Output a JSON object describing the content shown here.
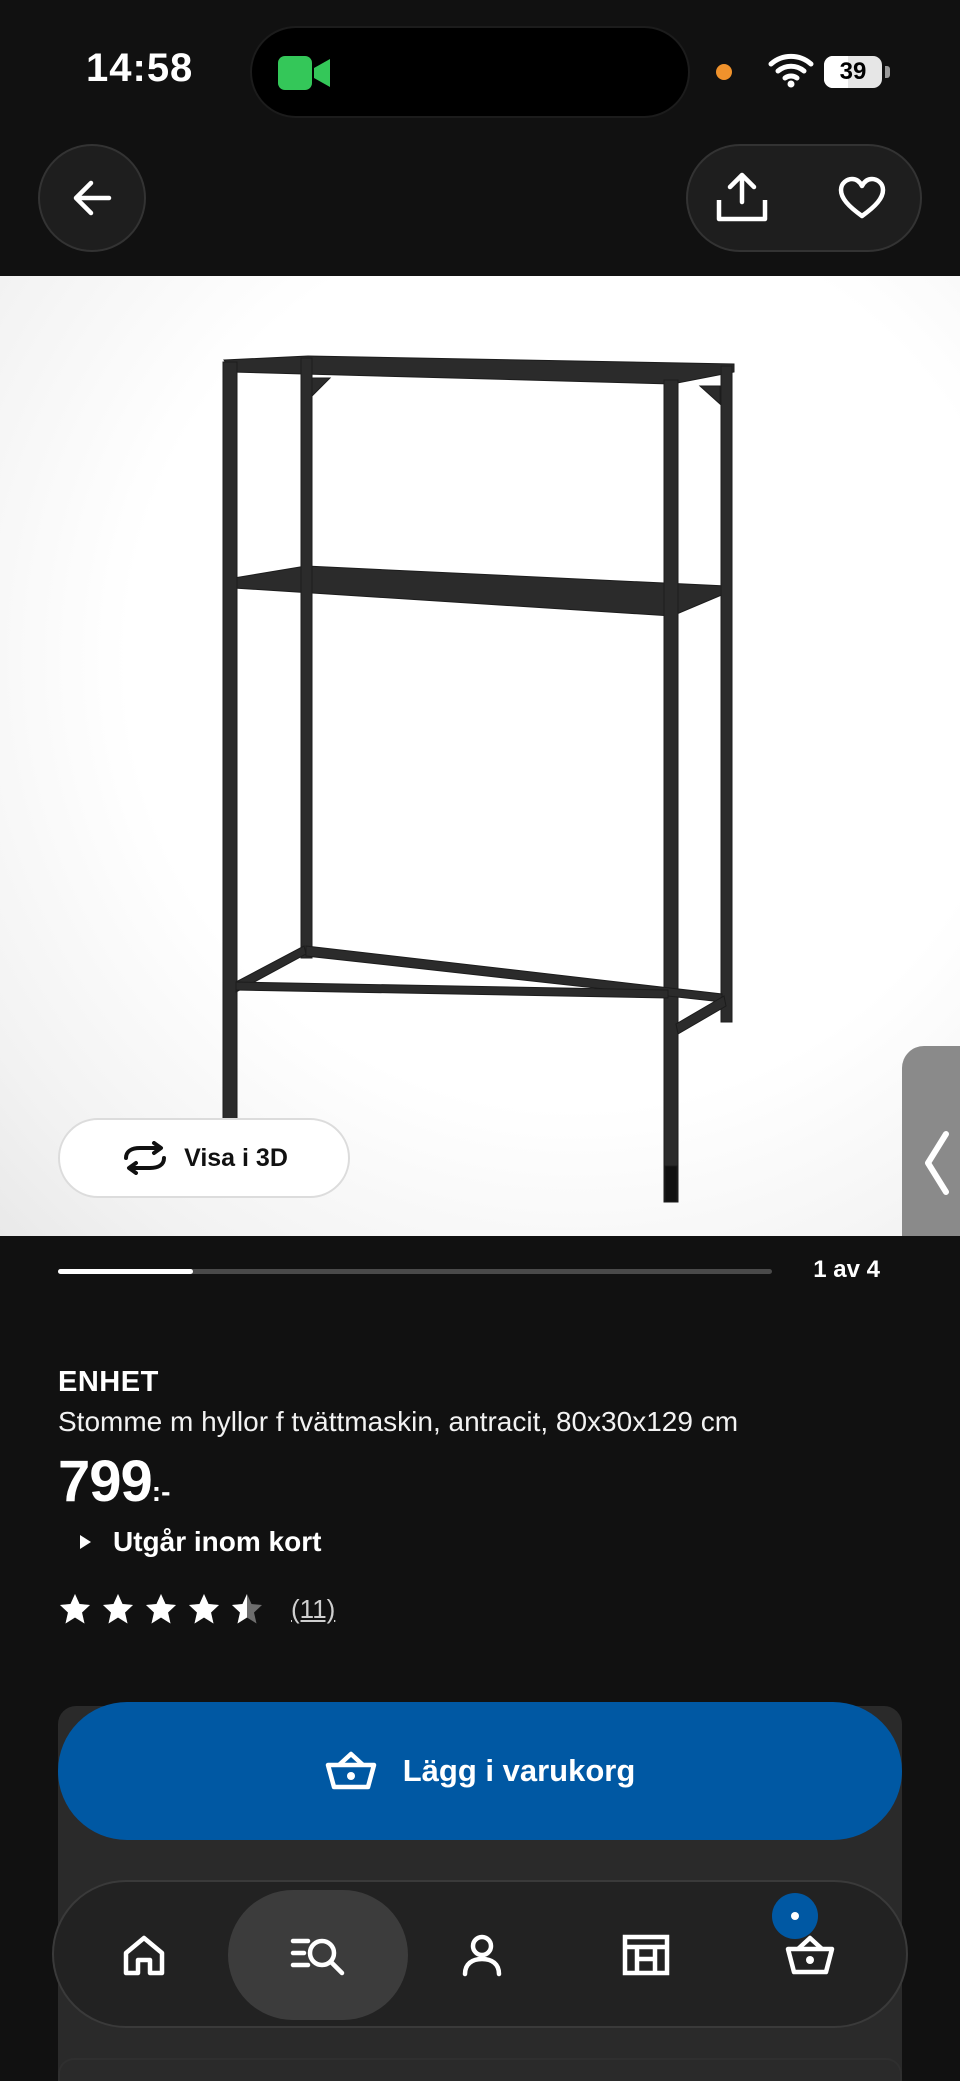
{
  "status_bar": {
    "time": "14:58",
    "battery": "39"
  },
  "nav": {
    "back_icon": "arrow-left-icon",
    "share_icon": "share-icon",
    "favorite_icon": "heart-icon"
  },
  "media": {
    "view_3d_label": "Visa i 3D",
    "view_3d_icon": "rotate-icon"
  },
  "carousel": {
    "counter": "1 av 4",
    "current": 1,
    "total": 4
  },
  "product": {
    "name": "ENHET",
    "description": "Stomme m hyllor f tvättmaskin, antracit, 80x30x129 cm",
    "price": "799",
    "price_suffix": ":-",
    "availability": "Utgår inom kort",
    "rating": 4.5,
    "review_count": "(11)"
  },
  "cart": {
    "add_label": "Lägg i varukorg"
  },
  "tab_bar": {
    "items": [
      {
        "icon": "home-icon"
      },
      {
        "icon": "search-icon",
        "active": true
      },
      {
        "icon": "profile-icon"
      },
      {
        "icon": "store-icon"
      },
      {
        "icon": "basket-icon"
      }
    ]
  },
  "colors": {
    "background": "#111111",
    "accent_blue": "#0058a3",
    "indicator_green": "#34c759",
    "indicator_orange": "#f0922c"
  }
}
